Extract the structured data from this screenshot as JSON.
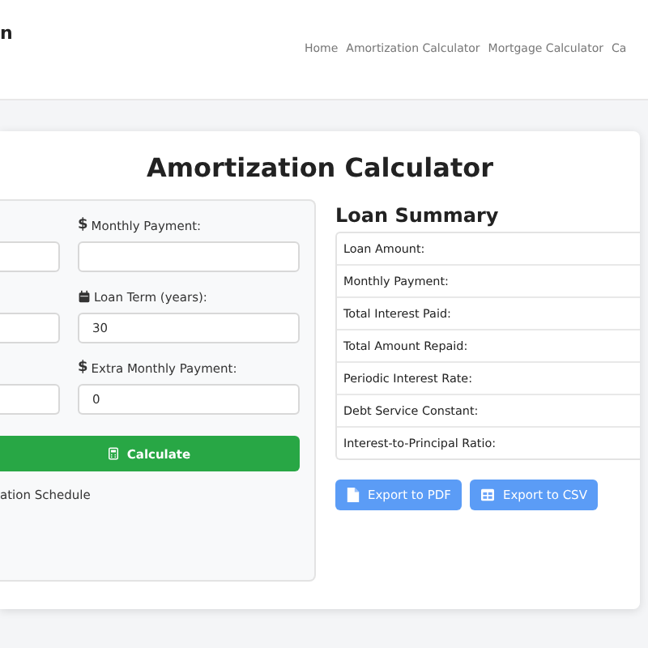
{
  "header": {
    "brand": "n",
    "nav": [
      "Home",
      "Amortization Calculator",
      "Mortgage Calculator",
      "Ca"
    ]
  },
  "title": "Amortization Calculator",
  "form": {
    "rows": [
      {
        "left_value": "",
        "kind": "symbol",
        "symbol": "$",
        "label": "Monthly Payment:",
        "value": ""
      },
      {
        "left_value": "",
        "kind": "calendar",
        "label": "Loan Term (years):",
        "value": "30"
      },
      {
        "left_value": "",
        "kind": "symbol",
        "symbol": "$",
        "label": "Extra Monthly Payment:",
        "value": "0"
      }
    ],
    "button": "Calculate",
    "option": "ation Schedule"
  },
  "summary": {
    "title": "Loan Summary",
    "rows": [
      "Loan Amount:",
      "Monthly Payment:",
      "Total Interest Paid:",
      "Total Amount Repaid:",
      "Periodic Interest Rate:",
      "Debt Service Constant:",
      "Interest-to-Principal Ratio:"
    ],
    "buttons": [
      {
        "kind": "pdf",
        "label": "Export to PDF"
      },
      {
        "kind": "csv",
        "label": "Export to CSV"
      }
    ]
  }
}
